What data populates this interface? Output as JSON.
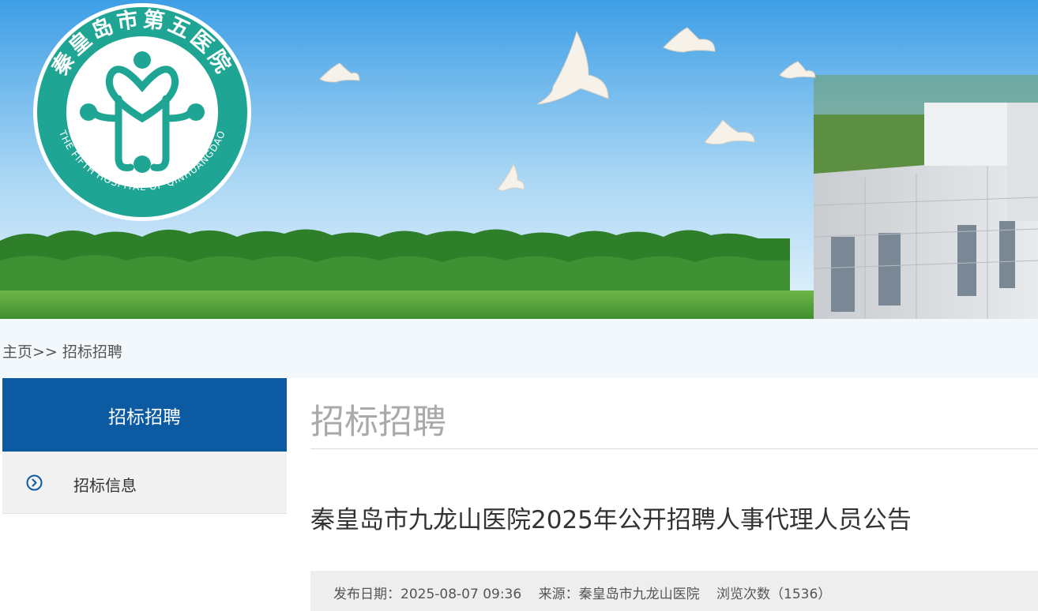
{
  "header": {
    "logo_name_cn": "秦皇岛市第五医院",
    "logo_name_en": "THE FIFTH HOSPITAL OF QINHUANGDAO",
    "colors": {
      "logo": "#1fa593",
      "sky_top": "#4aa6e8",
      "grass": "#4e9e3a"
    }
  },
  "breadcrumb": {
    "home": "主页",
    "separator": ">>",
    "current": "招标招聘"
  },
  "sidebar": {
    "title": "招标招聘",
    "items": [
      {
        "label": "招标信息",
        "icon": "circle-chevron-right-icon"
      }
    ],
    "colors": {
      "head": "#0b5aa2",
      "item_bg": "#f1f1f1"
    }
  },
  "main": {
    "section_title": "招标招聘",
    "article": {
      "title": "秦皇岛市九龙山医院2025年公开招聘人事代理人员公告",
      "date_label": "发布日期：",
      "date": "2025-08-07 09:36",
      "source_label": "来源：",
      "source": "秦皇岛市九龙山医院",
      "views_label": "浏览次数",
      "views": "（1536）"
    }
  }
}
